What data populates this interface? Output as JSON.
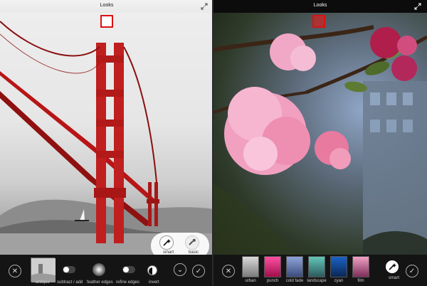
{
  "left": {
    "title": "Looks",
    "toolbar": {
      "close_icon": "close-icon",
      "confirm_icon": "checkmark-icon",
      "items": [
        {
          "label": "antique"
        },
        {
          "label": "subtract / add"
        },
        {
          "label": "feather edges"
        },
        {
          "label": "refine edges"
        },
        {
          "label": "invert"
        }
      ],
      "popup_modes": [
        {
          "label": "smart"
        },
        {
          "label": "basic"
        }
      ]
    }
  },
  "right": {
    "title": "Looks",
    "toolbar": {
      "close_icon": "close-icon",
      "confirm_icon": "checkmark-icon",
      "filters": [
        {
          "label": "urban"
        },
        {
          "label": "punch"
        },
        {
          "label": "cold fade"
        },
        {
          "label": "landscape"
        },
        {
          "label": "cyan"
        },
        {
          "label": "film"
        }
      ],
      "smart_label": "smart"
    }
  },
  "colors": {
    "toolbar_bg": "#141414",
    "marker_red": "#dd1111",
    "bridge_red": "#b81616"
  }
}
